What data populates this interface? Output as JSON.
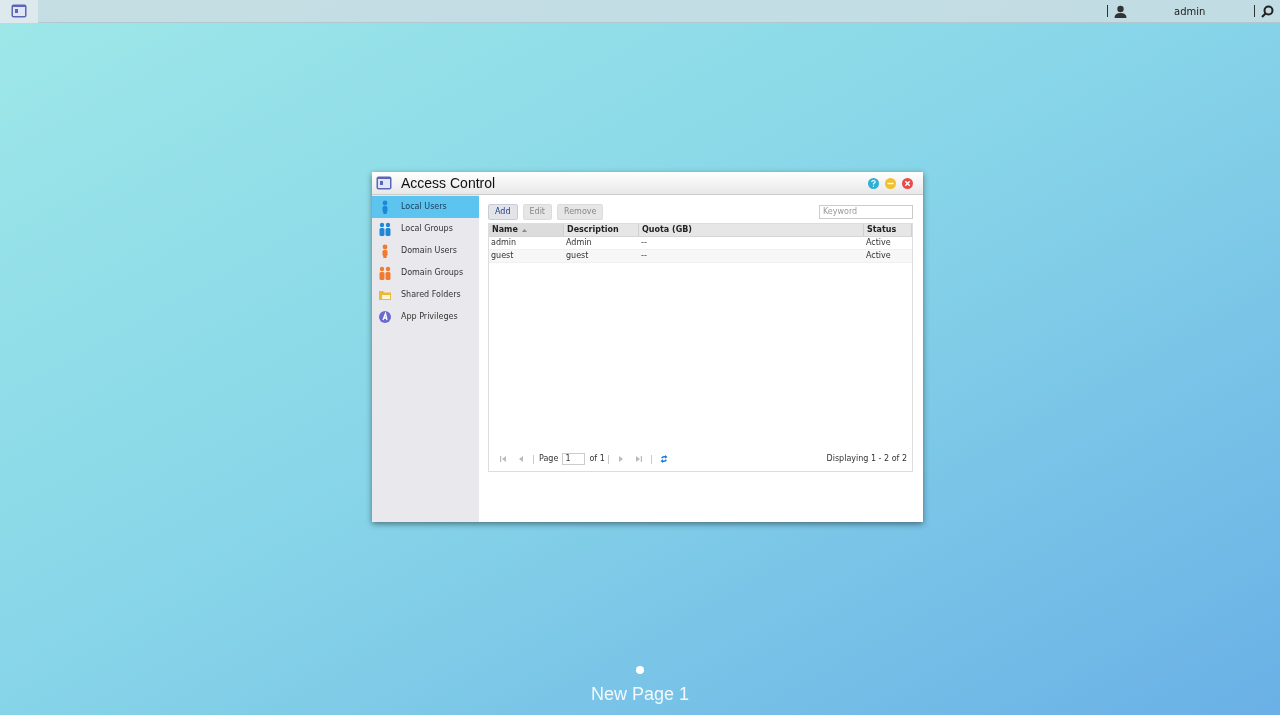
{
  "taskbar": {
    "user": "admin"
  },
  "window": {
    "title": "Access Control"
  },
  "sidebar": {
    "items": [
      {
        "label": "Local Users",
        "kind": "user",
        "color": "#1e88d8",
        "selected": true
      },
      {
        "label": "Local Groups",
        "kind": "group",
        "color": "#1e88d8",
        "selected": false
      },
      {
        "label": "Domain Users",
        "kind": "user",
        "color": "#f07a30",
        "selected": false
      },
      {
        "label": "Domain Groups",
        "kind": "group",
        "color": "#f07a30",
        "selected": false
      },
      {
        "label": "Shared Folders",
        "kind": "folder",
        "color": "#f0b830",
        "selected": false
      },
      {
        "label": "App Privileges",
        "kind": "app",
        "color": "#6a6ad0",
        "selected": false
      }
    ]
  },
  "toolbar": {
    "buttons": [
      {
        "label": "Add",
        "disabled": false
      },
      {
        "label": "Edit",
        "disabled": true
      },
      {
        "label": "Remove",
        "disabled": true
      }
    ],
    "search": {
      "placeholder": "Keyword"
    }
  },
  "table": {
    "columns": [
      {
        "label": "Name",
        "sorted": true
      },
      {
        "label": "Description",
        "sorted": false
      },
      {
        "label": "Quota (GB)",
        "sorted": false
      },
      {
        "label": "Status",
        "sorted": false
      }
    ],
    "rows": [
      [
        "admin",
        "Admin",
        "--",
        "Active"
      ],
      [
        "guest",
        "guest",
        "--",
        "Active"
      ]
    ]
  },
  "pager": {
    "page_label": "Page",
    "page": "1",
    "of": "of 1",
    "display": "Displaying 1 - 2 of 2"
  },
  "desktop": {
    "page_name": "New Page 1"
  }
}
